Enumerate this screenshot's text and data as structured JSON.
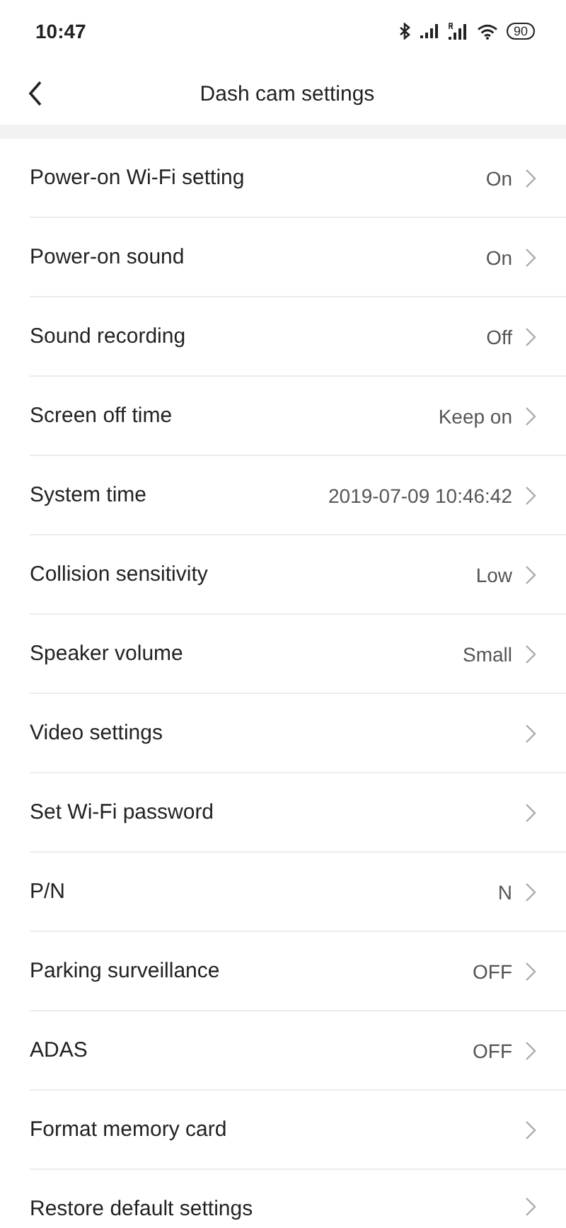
{
  "status_bar": {
    "time": "10:47",
    "battery": "90"
  },
  "header": {
    "title": "Dash cam settings"
  },
  "settings": [
    {
      "label": "Power-on Wi-Fi setting",
      "value": "On"
    },
    {
      "label": "Power-on sound",
      "value": "On"
    },
    {
      "label": "Sound recording",
      "value": "Off"
    },
    {
      "label": "Screen off time",
      "value": "Keep on"
    },
    {
      "label": "System time",
      "value": "2019-07-09 10:46:42"
    },
    {
      "label": "Collision sensitivity",
      "value": "Low"
    },
    {
      "label": "Speaker volume",
      "value": "Small"
    },
    {
      "label": "Video settings"
    },
    {
      "label": "Set Wi-Fi password"
    },
    {
      "label": "P/N",
      "value": "N"
    },
    {
      "label": "Parking surveillance",
      "value": "OFF"
    },
    {
      "label": "ADAS",
      "value": "OFF"
    },
    {
      "label": "Format memory card"
    },
    {
      "label": "Restore default settings"
    }
  ]
}
